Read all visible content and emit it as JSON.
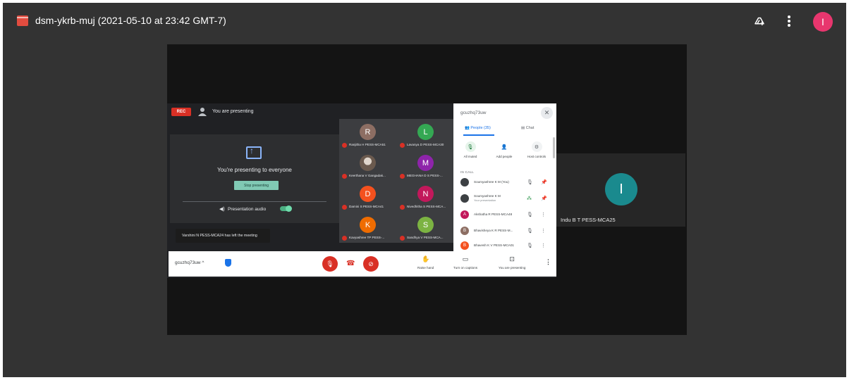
{
  "viewer": {
    "title": "dsm-ykrb-muj (2021-05-10 at 23:42 GMT-7)",
    "avatar_initial": "I",
    "icons": [
      "movie-file-icon",
      "add-to-drive-icon",
      "more-vert-icon"
    ]
  },
  "recording": {
    "rec_label": "REC",
    "presenting_label": "You are presenting",
    "panel_text": "You're presenting to everyone",
    "stop_button": "Stop presenting",
    "audio_label": "Presentation audio",
    "toast": "Varshini N PESS-MCA24 has left the meeting"
  },
  "grid": [
    {
      "initial": "R",
      "name": "Ranjitha H PESS-MCA51",
      "color": "#8d6e63"
    },
    {
      "initial": "L",
      "name": "Lavanya D PESS-MCA30",
      "color": "#34a853"
    },
    {
      "initial": "",
      "name": "Keerthana V Gangadak...",
      "color": "#9e9e9e"
    },
    {
      "initial": "M",
      "name": "MEGHANA D S PESS-...",
      "color": "#8e24aa"
    },
    {
      "initial": "D",
      "name": "Damini S PESS-MCA41",
      "color": "#f4511e"
    },
    {
      "initial": "N",
      "name": "Nivedhitha S PESS-MCA...",
      "color": "#c2185b"
    },
    {
      "initial": "K",
      "name": "Kavyashree TP PESS-...",
      "color": "#ef6c00"
    },
    {
      "initial": "S",
      "name": "Sandhya V PESS-MCA...",
      "color": "#7cb342"
    }
  ],
  "people_panel": {
    "meeting_code": "gcuzhq73uw",
    "tab_people": "People (35)",
    "tab_chat": "Chat",
    "actions": [
      "All muted",
      "Add people",
      "Host controls"
    ],
    "in_call": "IN CALL",
    "rows": [
      {
        "initial": "",
        "name": "Soumyashree K M (You)",
        "sub": "",
        "color": "#3c4043"
      },
      {
        "initial": "",
        "name": "Soumyashree K M",
        "sub": "Your presentation",
        "color": "#3c4043"
      },
      {
        "initial": "A",
        "name": "Akshatha R PESS-MCA48",
        "sub": "",
        "color": "#c2185b"
      },
      {
        "initial": "B",
        "name": "Bhavisheya K R PESS-M...",
        "sub": "",
        "color": "#8d6e63"
      },
      {
        "initial": "B",
        "name": "Bhavesh K V PESS-MCA01",
        "sub": "",
        "color": "#f4511e"
      }
    ]
  },
  "controls": {
    "meeting_code": "gcuzhq73uw",
    "raise_hand": "Raise hand",
    "captions": "Turn on captions",
    "presenting": "You are presenting"
  },
  "side_tile": {
    "initial": "I",
    "name": "Indu B T PESS-MCA25"
  }
}
